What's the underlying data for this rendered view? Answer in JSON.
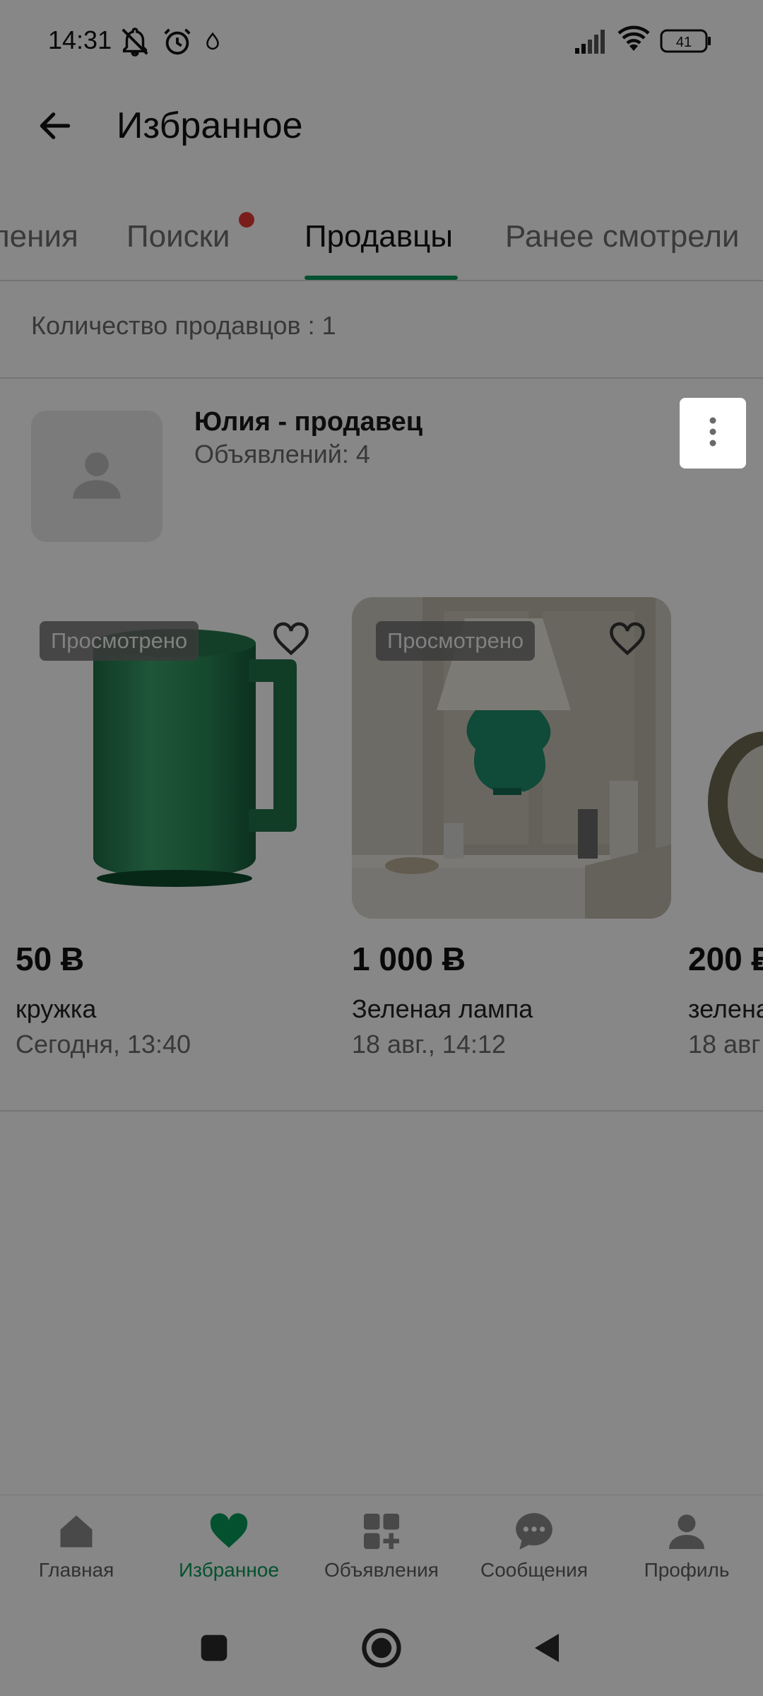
{
  "status_bar": {
    "time": "14:31",
    "battery": "41",
    "icons": [
      "bell-off-icon",
      "alarm-icon",
      "drop-icon",
      "signal-icon",
      "wifi-icon",
      "battery-icon"
    ]
  },
  "app_bar": {
    "back_icon": "arrow-left-icon",
    "title": "Избранное"
  },
  "tabs": [
    {
      "label": "ления",
      "active": false
    },
    {
      "label": "Поиски",
      "active": false,
      "has_dot": true
    },
    {
      "label": "Продавцы",
      "active": true
    },
    {
      "label": "Ранее смотрели",
      "active": false
    }
  ],
  "colors": {
    "accent": "#079a5a",
    "dot": "#e53935",
    "overlay": "rgba(0,0,0,0.47)"
  },
  "sellers_count_text": "Количество продавцов : 1",
  "seller": {
    "name": "Юлия - продавец",
    "ads": "Объявлений: 4",
    "avatar_icon": "person-icon",
    "more_icon": "more-vert-icon"
  },
  "products": [
    {
      "badge": "Просмотрено",
      "price": "50 Ƀ",
      "name": "кружка",
      "date": "Сегодня, 13:40"
    },
    {
      "badge": "Просмотрено",
      "price": "1 000 Ƀ",
      "name": "Зеленая лампа",
      "date": "18 авг., 14:12"
    },
    {
      "badge": "",
      "price": "200 Ƀ",
      "name": "зелена",
      "date": "18 авг"
    }
  ],
  "bottom_nav": [
    {
      "label": "Главная",
      "icon": "home-icon",
      "active": false
    },
    {
      "label": "Избранное",
      "icon": "heart-icon",
      "active": true
    },
    {
      "label": "Объявления",
      "icon": "grid-plus-icon",
      "active": false
    },
    {
      "label": "Сообщения",
      "icon": "chat-icon",
      "active": false
    },
    {
      "label": "Профиль",
      "icon": "person-icon",
      "active": false
    }
  ],
  "system_nav": [
    "recents-icon",
    "home-circle-icon",
    "back-triangle-icon"
  ]
}
